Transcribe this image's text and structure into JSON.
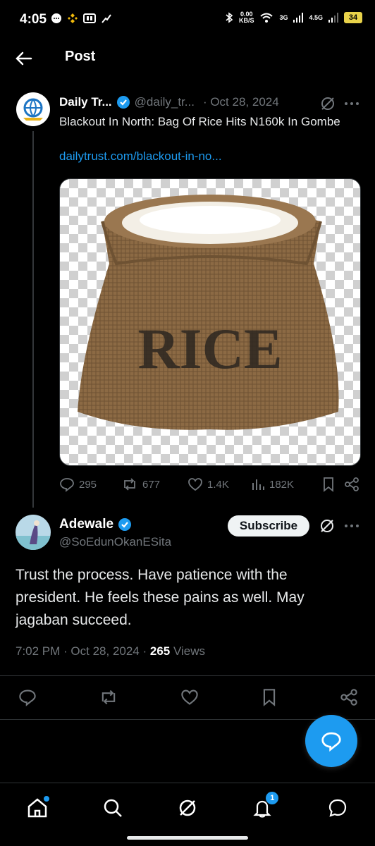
{
  "status_bar": {
    "time": "4:05",
    "net_speed": "0.00",
    "net_unit": "KB/S",
    "signal1": "3G",
    "signal2": "4.5G",
    "battery": "34"
  },
  "header": {
    "title": "Post"
  },
  "quoted_tweet": {
    "name": "Daily Tr...",
    "handle": "@daily_tr...",
    "date": "· Oct 28, 2024",
    "text": "Blackout In North: Bag Of Rice Hits N160k In Gombe",
    "link": "dailytrust.com/blackout-in-no...",
    "image_label": "RICE",
    "stats": {
      "replies": "295",
      "reposts": "677",
      "likes": "1.4K",
      "views": "182K"
    }
  },
  "main_tweet": {
    "name": "Adewale",
    "handle": "@SoEdunOkanESita",
    "subscribe_label": "Subscribe",
    "text": "Trust the process. Have patience with the president. He feels these pains as well. May jagaban succeed.",
    "time": "7:02 PM · Oct 28, 2024 · ",
    "views_count": "265",
    "views_label": " Views"
  },
  "bottom_nav": {
    "notifications_badge": "1"
  },
  "colors": {
    "accent": "#1d9bf0",
    "background": "#000000",
    "muted": "#71767b"
  }
}
